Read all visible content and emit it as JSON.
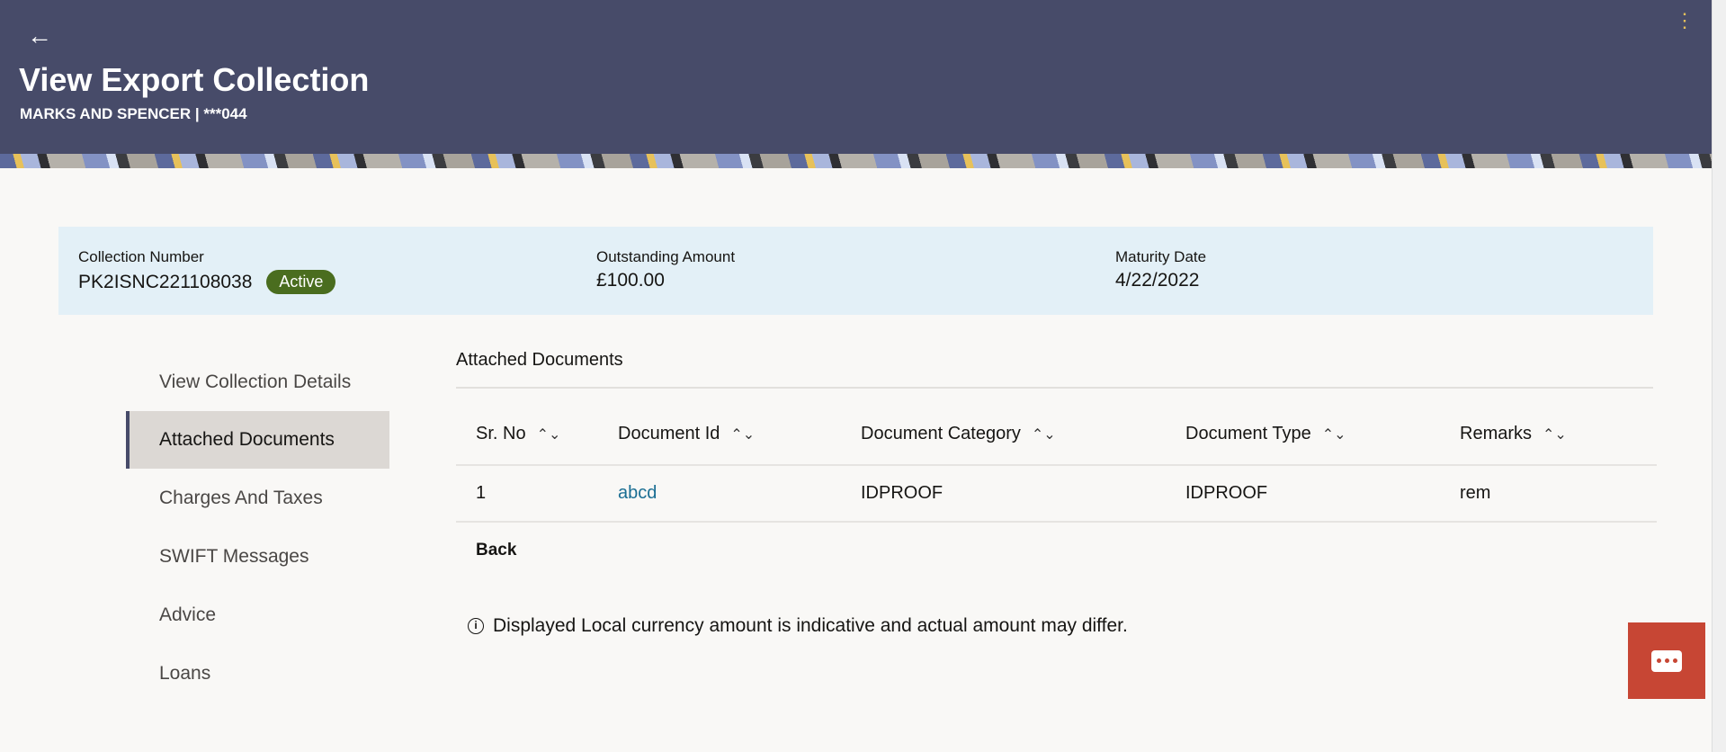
{
  "header": {
    "title": "View Export Collection",
    "subtitle": "MARKS AND SPENCER | ***044",
    "back_icon": "←",
    "menu_icon": "⋮"
  },
  "summary": {
    "collection_number_label": "Collection Number",
    "collection_number": "PK2ISNC221108038",
    "status": "Active",
    "outstanding_label": "Outstanding Amount",
    "outstanding": "£100.00",
    "maturity_label": "Maturity Date",
    "maturity": "4/22/2022"
  },
  "nav": {
    "items": [
      {
        "label": "View Collection Details"
      },
      {
        "label": "Attached Documents"
      },
      {
        "label": "Charges And Taxes"
      },
      {
        "label": "SWIFT Messages"
      },
      {
        "label": "Advice"
      },
      {
        "label": "Loans"
      }
    ]
  },
  "documents": {
    "title": "Attached Documents",
    "columns": [
      "Sr. No",
      "Document Id",
      "Document Category",
      "Document Type",
      "Remarks"
    ],
    "rows": [
      {
        "sr": "1",
        "id": "abcd",
        "category": "IDPROOF",
        "type": "IDPROOF",
        "remarks": "rem"
      }
    ],
    "back_label": "Back"
  },
  "info_text": "Displayed Local currency amount is indicative and actual amount may differ.",
  "colors": {
    "header": "#474b69",
    "badge": "#4a6d1f",
    "chat": "#c74634",
    "link": "#1a6e93"
  }
}
